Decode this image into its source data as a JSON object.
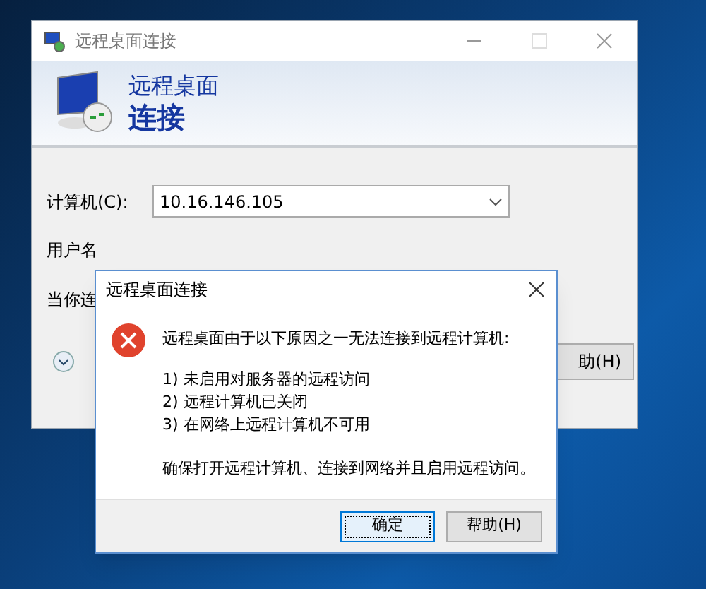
{
  "main_window": {
    "title": "远程桌面连接",
    "banner": {
      "line_1": "远程桌面",
      "line_2": "连接"
    },
    "computer": {
      "label": "计算机(C):",
      "value": "10.16.146.105"
    },
    "username_label": "用户名",
    "hint_label": "当你连",
    "help_button": "助(H)"
  },
  "dialog": {
    "title": "远程桌面连接",
    "message": "远程桌面由于以下原因之一无法连接到远程计算机:",
    "reasons": [
      "1) 未启用对服务器的远程访问",
      "2) 远程计算机已关闭",
      "3) 在网络上远程计算机不可用"
    ],
    "advice": "确保打开远程计算机、连接到网络并且启用远程访问。",
    "buttons": [
      {
        "label": "确定",
        "selected": true
      },
      {
        "label": "帮助(H)",
        "selected": false
      }
    ]
  }
}
